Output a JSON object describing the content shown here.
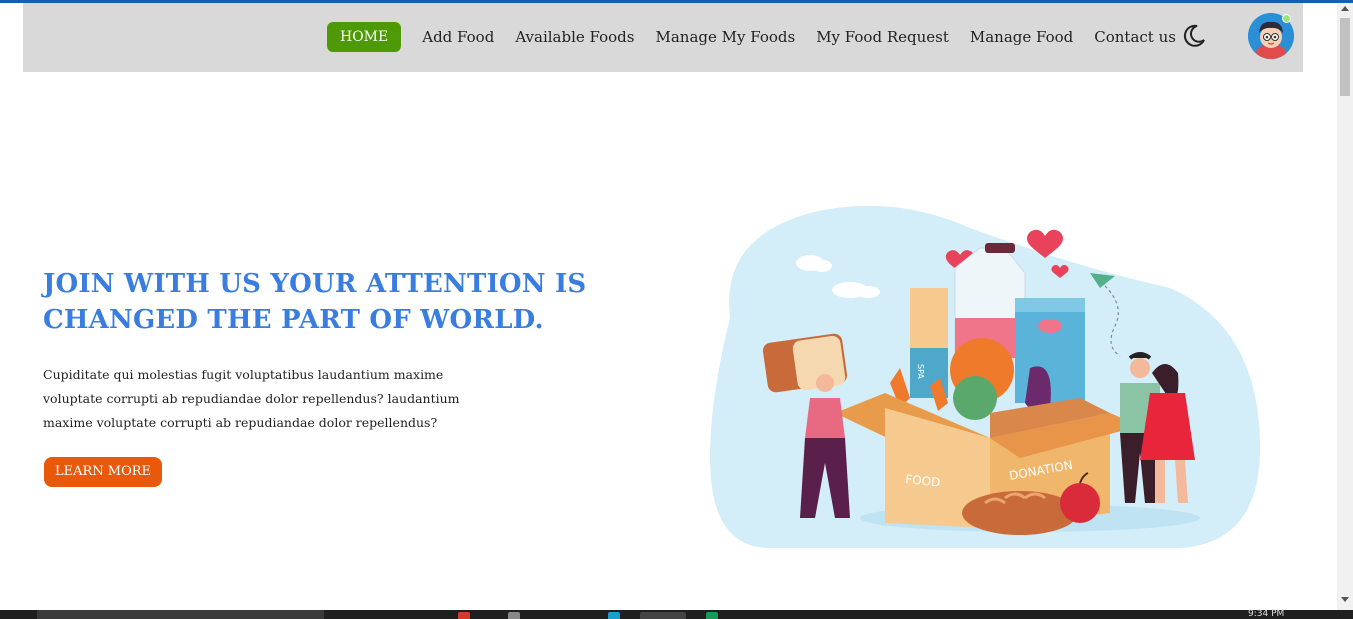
{
  "nav": {
    "home": "HOME",
    "links": [
      "Add Food",
      "Available Foods",
      "Manage My Foods",
      "My Food Request",
      "Manage Food",
      "Contact us"
    ],
    "theme_icon": "moon-icon",
    "avatar_icon": "user-avatar"
  },
  "hero": {
    "title_line1": "JOIN WITH US YOUR ATTENTION IS",
    "title_line2": "CHANGED THE PART OF WORLD.",
    "text_line1": "Cupiditate qui molestias fugit voluptatibus laudantium maxime",
    "text_line2": "voluptate corrupti ab repudiandae dolor repellendus? laudantium",
    "text_line3": "maxime voluptate corrupti ab repudiandae dolor repellendus?",
    "button": "LEARN MORE"
  },
  "illustration": {
    "box_label_left": "FOOD",
    "box_label_right": "DONATION",
    "pasta_label": "SPA"
  },
  "taskbar": {
    "clock": "9:34 PM"
  },
  "colors": {
    "accent_blue": "#3a7de0",
    "home_green": "#4e9a06",
    "button_orange": "#e8590c",
    "navbar_bg": "#d9d9d9"
  }
}
